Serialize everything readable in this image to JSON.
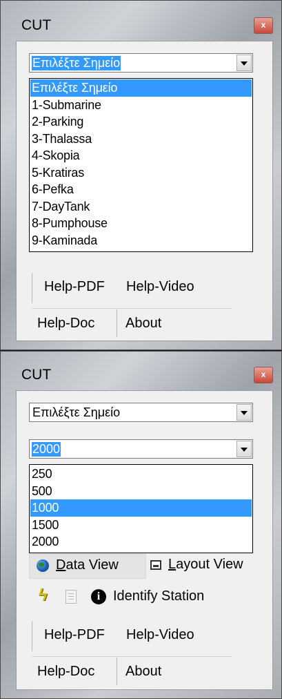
{
  "window1": {
    "title": "CUT",
    "close_glyph": "x",
    "combo_selected": "Επιλέξτε Σημείο",
    "list_items": [
      "Επιλέξτε Σημείο",
      "1-Submarine",
      "2-Parking",
      "3-Thalassa",
      "4-Skopia",
      "5-Kratiras",
      "6-Pefka",
      "7-DayTank",
      "8-Pumphouse",
      "9-Kaminada"
    ],
    "highlighted_index": 0,
    "help_pdf": "Help-PDF",
    "help_video": "Help-Video",
    "help_doc": "Help-Doc",
    "about": "About"
  },
  "window2": {
    "title": "CUT",
    "close_glyph": "x",
    "combo_point": "Επιλέξτε Σημείο",
    "combo_scale": "2000",
    "scale_items": [
      "250",
      "500",
      "1000",
      "1500",
      "2000"
    ],
    "highlighted_index": 2,
    "data_view_prefix": "",
    "data_view_mnemonic": "D",
    "data_view_rest": "ata View",
    "layout_view_mnemonic": "L",
    "layout_view_rest": "ayout View",
    "identify_station": "Identify Station",
    "help_pdf": "Help-PDF",
    "help_video": "Help-Video",
    "help_doc": "Help-Doc",
    "about": "About"
  },
  "icons": {
    "globe": "globe-icon",
    "layout": "layout-view-icon",
    "bolt": "lightning-icon",
    "memo": "memo-icon",
    "info": "info-icon"
  },
  "colors": {
    "selection": "#3399ff",
    "bolt": "#d8c400"
  }
}
